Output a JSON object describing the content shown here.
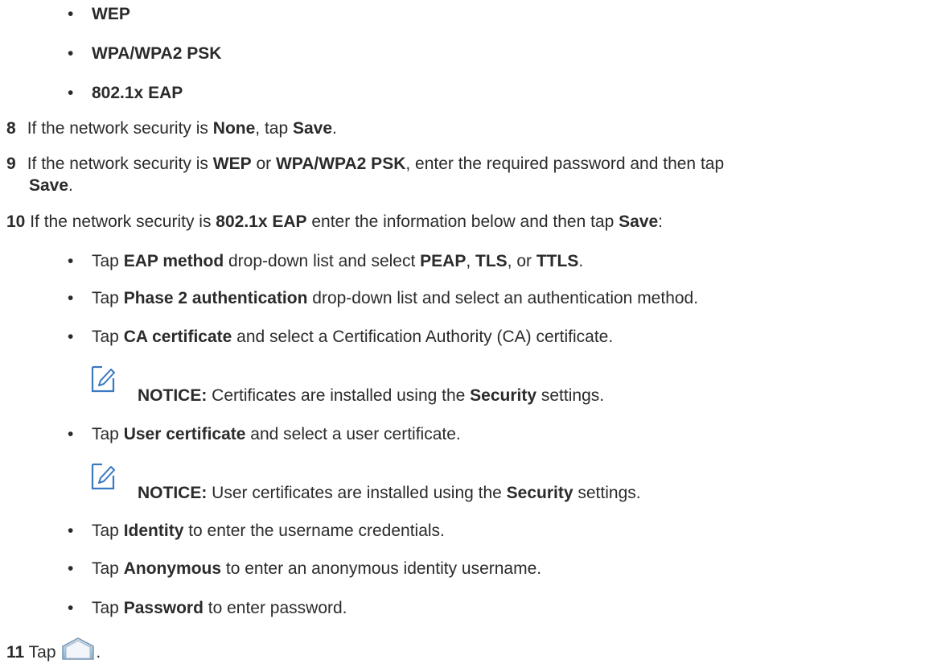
{
  "security_options": [
    "WEP",
    "WPA/WPA2 PSK",
    "802.1x EAP"
  ],
  "step8": {
    "number": "8",
    "t1": "If the network security is ",
    "b1": "None",
    "t2": ", tap ",
    "b2": "Save",
    "t3": "."
  },
  "step9": {
    "number": "9",
    "t1": "If the network security is ",
    "b1": "WEP",
    "t2": " or ",
    "b2": "WPA/WPA2 PSK",
    "t3": ", enter the required password and then tap",
    "b3": "Save",
    "t4": "."
  },
  "step10": {
    "number": "10",
    "t1": " If the network security is ",
    "b1": "802.1x EAP",
    "t2": " enter the information below and then tap ",
    "b2": "Save",
    "t3": ":"
  },
  "eap_items": {
    "method": {
      "t1": "Tap ",
      "b1": "EAP method",
      "t2": " drop-down list and select ",
      "b2": "PEAP",
      "t3": ", ",
      "b3": "TLS",
      "t4": ", or ",
      "b4": "TTLS",
      "t5": "."
    },
    "phase2": {
      "t1": "Tap ",
      "b1": "Phase 2 authentication",
      "t2": " drop-down list and select an authentication method."
    },
    "ca": {
      "t1": "Tap ",
      "b1": "CA certificate",
      "t2": " and select a Certification Authority (CA) certificate."
    },
    "notice1": {
      "label": "NOTICE:",
      "t1": " Certificates are installed using the ",
      "b1": "Security",
      "t2": " settings."
    },
    "user": {
      "t1": "Tap ",
      "b1": "User certificate",
      "t2": " and select a user certificate."
    },
    "notice2": {
      "label": "NOTICE:",
      "t1": " User certificates are installed using the ",
      "b1": "Security",
      "t2": " settings."
    },
    "identity": {
      "t1": "Tap ",
      "b1": "Identity",
      "t2": " to enter the username credentials."
    },
    "anonymous": {
      "t1": "Tap ",
      "b1": "Anonymous",
      "t2": " to enter an anonymous identity username."
    },
    "password": {
      "t1": "Tap ",
      "b1": "Password",
      "t2": " to enter password."
    }
  },
  "step11": {
    "number": "11",
    "t1": " Tap ",
    "t2": "."
  },
  "bullet": "•",
  "icon_color": "#3a78c2"
}
